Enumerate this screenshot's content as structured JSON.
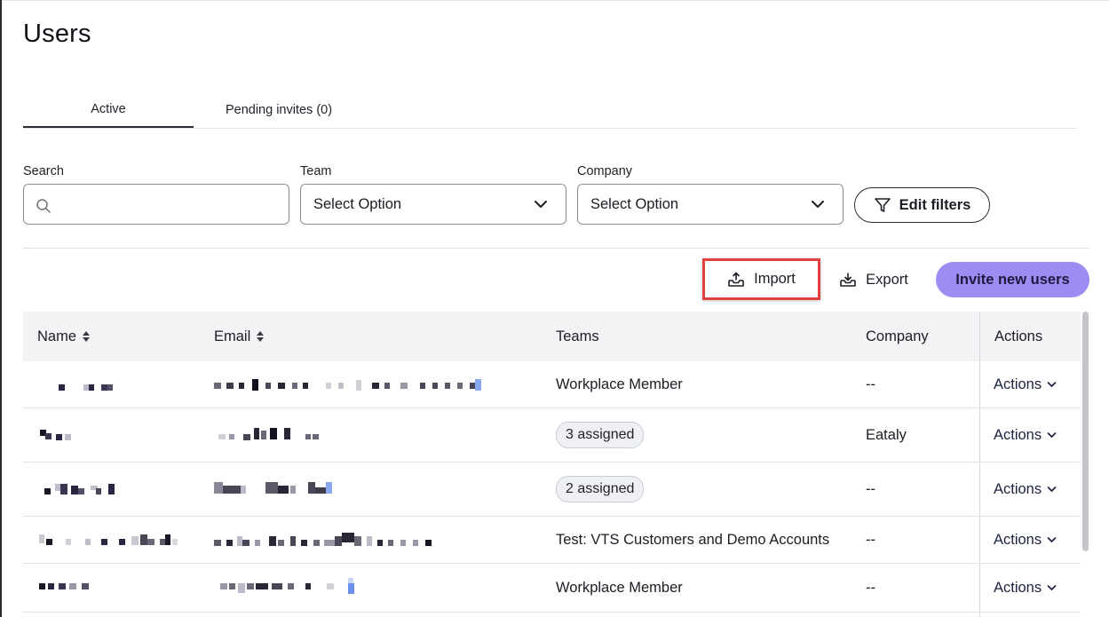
{
  "page": {
    "title": "Users"
  },
  "tabs": [
    {
      "label": "Active",
      "active": true
    },
    {
      "label": "Pending invites (0)",
      "active": false
    }
  ],
  "filters": {
    "search": {
      "label": "Search",
      "value": "",
      "placeholder": ""
    },
    "team": {
      "label": "Team",
      "value": "Select Option"
    },
    "company": {
      "label": "Company",
      "value": "Select Option"
    },
    "edit_filters_label": "Edit filters"
  },
  "toolbar": {
    "import_label": "Import",
    "export_label": "Export",
    "invite_label": "Invite new users"
  },
  "table": {
    "columns": {
      "name": "Name",
      "email": "Email",
      "teams": "Teams",
      "company": "Company",
      "actions": "Actions"
    },
    "rows": [
      {
        "teams": "Workplace Member",
        "teams_chip": false,
        "company": "--",
        "actions": "Actions"
      },
      {
        "teams": "3 assigned",
        "teams_chip": true,
        "company": "Eataly",
        "actions": "Actions"
      },
      {
        "teams": "2 assigned",
        "teams_chip": true,
        "company": "--",
        "actions": "Actions"
      },
      {
        "teams": "Test: VTS Customers and Demo Accounts",
        "teams_chip": false,
        "company": "--",
        "actions": "Actions"
      },
      {
        "teams": "Workplace Member",
        "teams_chip": false,
        "company": "--",
        "actions": "Actions"
      }
    ]
  },
  "colors": {
    "accent": "#9b8df2",
    "highlight": "#e0413f",
    "header_bg": "#f3f3f6"
  },
  "icons": [
    "search-icon",
    "chevron-down-icon",
    "filter-icon",
    "upload-icon",
    "download-icon",
    "sort-icon"
  ]
}
